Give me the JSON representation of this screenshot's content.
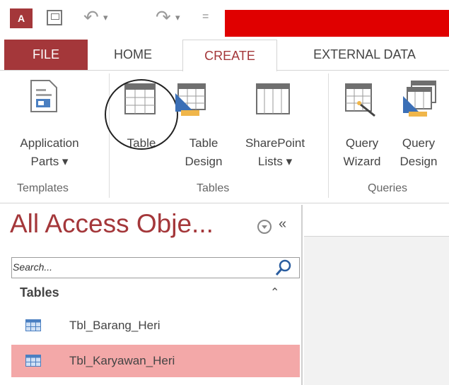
{
  "qat": {
    "app_icon_text": "A",
    "undo_glyph": "↶",
    "redo_glyph": "↷",
    "dropdown_glyph": "▾",
    "customize_glyph": "="
  },
  "tabs": [
    {
      "label": "FILE"
    },
    {
      "label": "HOME"
    },
    {
      "label": "CREATE"
    },
    {
      "label": "EXTERNAL DATA"
    }
  ],
  "ribbon": {
    "templates": {
      "group_label": "Templates",
      "application_parts": [
        "Application",
        "Parts ▾"
      ]
    },
    "tables": {
      "group_label": "Tables",
      "table": "Table",
      "table_design": [
        "Table",
        "Design"
      ],
      "sharepoint_lists": [
        "SharePoint",
        "Lists ▾"
      ]
    },
    "queries": {
      "group_label": "Queries",
      "query_wizard": [
        "Query",
        "Wizard"
      ],
      "query_design": [
        "Query",
        "Design"
      ]
    }
  },
  "nav": {
    "title": "All Access Obje...",
    "collapse_glyph": "«",
    "search": {
      "placeholder": "Search..."
    },
    "section": {
      "label": "Tables",
      "chevron": "⌃"
    },
    "items": [
      {
        "label": "Tbl_Barang_Heri",
        "selected": false
      },
      {
        "label": "Tbl_Karyawan_Heri",
        "selected": true
      }
    ]
  },
  "colors": {
    "accent": "#a4373a",
    "selected_row": "#f3a8a8",
    "title_bar_red": "#e00000",
    "table_icon_blue": "#4a7fc1"
  }
}
